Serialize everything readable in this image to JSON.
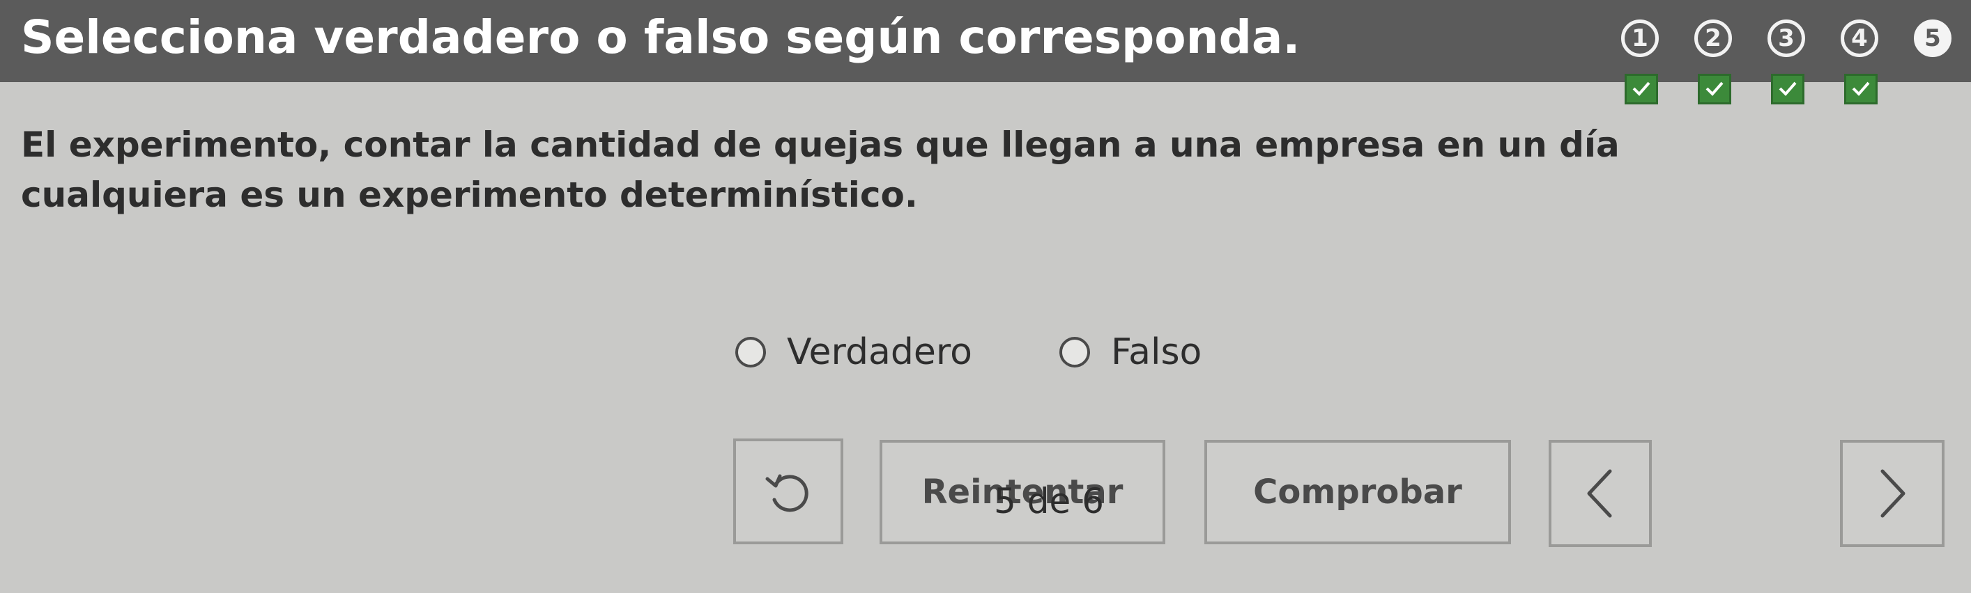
{
  "header": {
    "title": "Selecciona verdadero o falso según corresponda."
  },
  "steps": [
    {
      "label": "1",
      "state": "answered"
    },
    {
      "label": "2",
      "state": "answered"
    },
    {
      "label": "3",
      "state": "answered"
    },
    {
      "label": "4",
      "state": "answered"
    },
    {
      "label": "5",
      "state": "current"
    }
  ],
  "question": {
    "text": "El experimento, contar la cantidad de quejas que llegan a una empresa en un día cualquiera es un experimento determinístico."
  },
  "options": [
    {
      "label": "Verdadero",
      "selected": false
    },
    {
      "label": "Falso",
      "selected": false
    }
  ],
  "controls": {
    "reset_icon": "undo-icon",
    "retry_label": "Reintentar",
    "check_label": "Comprobar",
    "prev_icon": "chevron-left-icon",
    "next_icon": "chevron-right-icon",
    "page_counter": "5 de 6"
  },
  "colors": {
    "header_bg": "#5b5b5b",
    "page_bg": "#c9c9c7",
    "check_green": "#3c8a3a"
  }
}
